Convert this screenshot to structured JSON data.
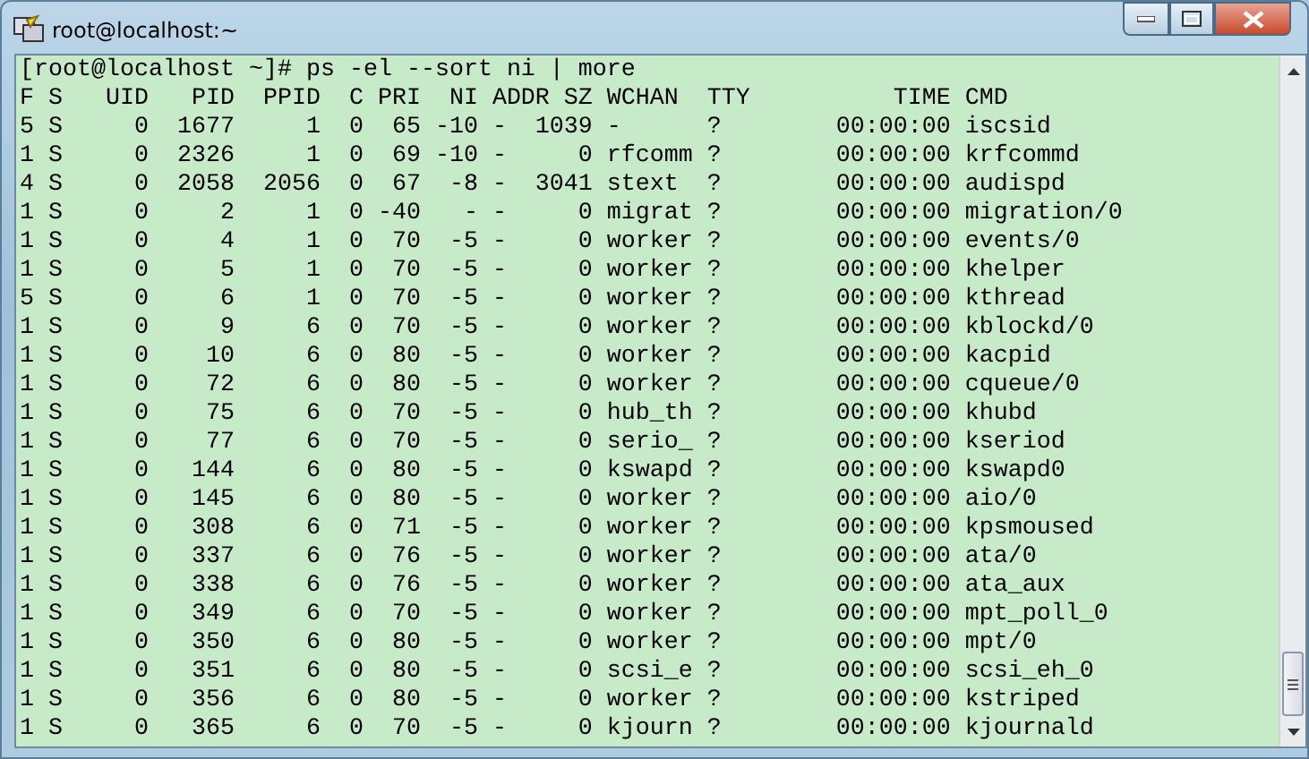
{
  "window": {
    "title": "root@localhost:~"
  },
  "terminal": {
    "lines": [
      "[root@localhost ~]# ps -el --sort ni | more",
      "F S   UID   PID  PPID  C PRI  NI ADDR SZ WCHAN  TTY          TIME CMD",
      "5 S     0  1677     1  0  65 -10 -  1039 -      ?        00:00:00 iscsid",
      "1 S     0  2326     1  0  69 -10 -     0 rfcomm ?        00:00:00 krfcommd",
      "4 S     0  2058  2056  0  67  -8 -  3041 stext  ?        00:00:00 audispd",
      "1 S     0     2     1  0 -40   - -     0 migrat ?        00:00:00 migration/0",
      "1 S     0     4     1  0  70  -5 -     0 worker ?        00:00:00 events/0",
      "1 S     0     5     1  0  70  -5 -     0 worker ?        00:00:00 khelper",
      "5 S     0     6     1  0  70  -5 -     0 worker ?        00:00:00 kthread",
      "1 S     0     9     6  0  70  -5 -     0 worker ?        00:00:00 kblockd/0",
      "1 S     0    10     6  0  80  -5 -     0 worker ?        00:00:00 kacpid",
      "1 S     0    72     6  0  80  -5 -     0 worker ?        00:00:00 cqueue/0",
      "1 S     0    75     6  0  70  -5 -     0 hub_th ?        00:00:00 khubd",
      "1 S     0    77     6  0  70  -5 -     0 serio_ ?        00:00:00 kseriod",
      "1 S     0   144     6  0  80  -5 -     0 kswapd ?        00:00:00 kswapd0",
      "1 S     0   145     6  0  80  -5 -     0 worker ?        00:00:00 aio/0",
      "1 S     0   308     6  0  71  -5 -     0 worker ?        00:00:00 kpsmoused",
      "1 S     0   337     6  0  76  -5 -     0 worker ?        00:00:00 ata/0",
      "1 S     0   338     6  0  76  -5 -     0 worker ?        00:00:00 ata_aux",
      "1 S     0   349     6  0  70  -5 -     0 worker ?        00:00:00 mpt_poll_0",
      "1 S     0   350     6  0  80  -5 -     0 worker ?        00:00:00 mpt/0",
      "1 S     0   351     6  0  80  -5 -     0 scsi_e ?        00:00:00 scsi_eh_0",
      "1 S     0   356     6  0  80  -5 -     0 worker ?        00:00:00 kstriped",
      "1 S     0   365     6  0  70  -5 -     0 kjourn ?        00:00:00 kjournald"
    ]
  }
}
